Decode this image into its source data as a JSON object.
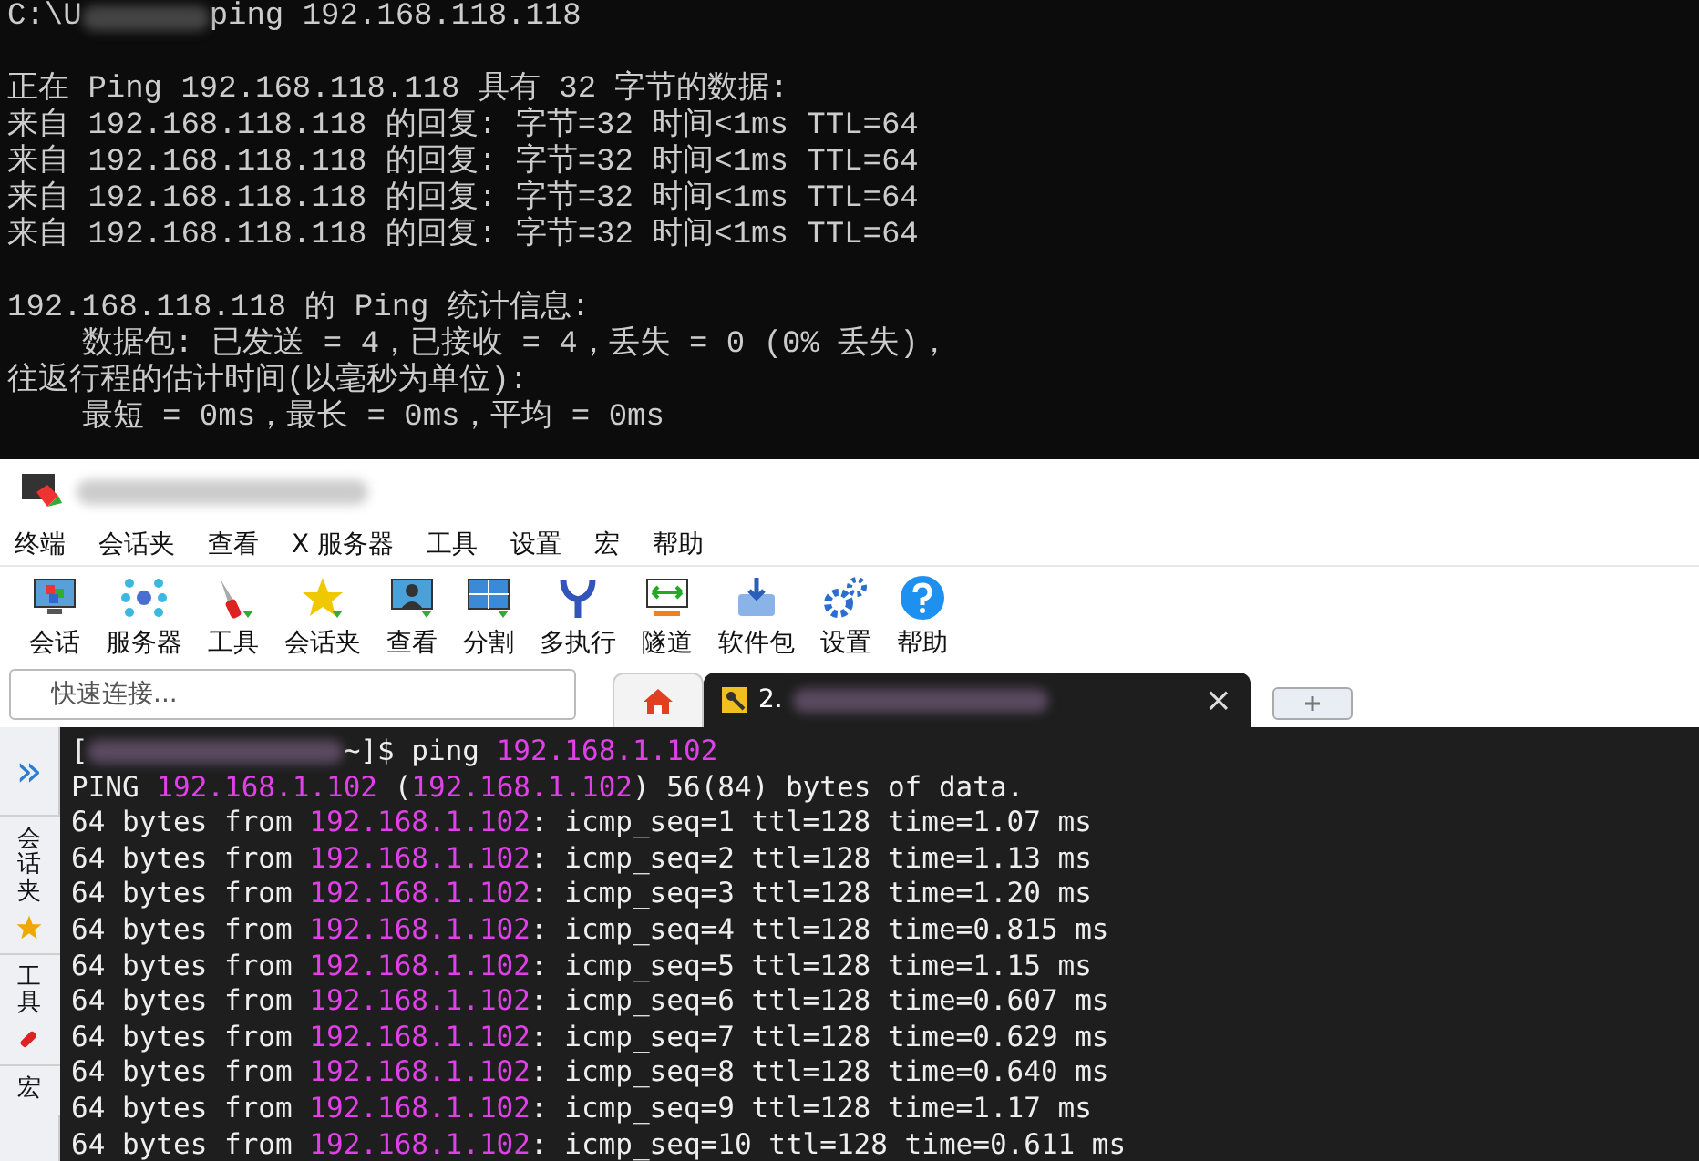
{
  "cmd": {
    "prompt_start": "C:\\U",
    "command": "ping 192.168.118.118",
    "lines": [
      {
        "text": "正在 Ping 192.168.118.118 具有 32 字节的数据:",
        "gap_before": true
      },
      {
        "text": "来自 192.168.118.118 的回复: 字节=32 时间<1ms TTL=64",
        "gap_before": false
      },
      {
        "text": "来自 192.168.118.118 的回复: 字节=32 时间<1ms TTL=64",
        "gap_before": false
      },
      {
        "text": "来自 192.168.118.118 的回复: 字节=32 时间<1ms TTL=64",
        "gap_before": false
      },
      {
        "text": "来自 192.168.118.118 的回复: 字节=32 时间<1ms TTL=64",
        "gap_before": false
      },
      {
        "text": "192.168.118.118 的 Ping 统计信息:",
        "gap_before": true
      },
      {
        "text": "    数据包: 已发送 = 4，已接收 = 4，丢失 = 0 (0% 丢失)，",
        "gap_before": false
      },
      {
        "text": "往返行程的估计时间(以毫秒为单位):",
        "gap_before": false
      },
      {
        "text": "    最短 = 0ms，最长 = 0ms，平均 = 0ms",
        "gap_before": false
      }
    ]
  },
  "xshell": {
    "menu": [
      "终端",
      "会话夹",
      "查看",
      "X 服务器",
      "工具",
      "设置",
      "宏",
      "帮助"
    ],
    "toolbar": [
      {
        "kind": "session",
        "label": "会话"
      },
      {
        "kind": "server",
        "label": "服务器"
      },
      {
        "kind": "tools",
        "label": "工具"
      },
      {
        "kind": "favorites",
        "label": "会话夹"
      },
      {
        "kind": "view",
        "label": "查看"
      },
      {
        "kind": "split",
        "label": "分割"
      },
      {
        "kind": "multi",
        "label": "多执行"
      },
      {
        "kind": "tunnel",
        "label": "隧道"
      },
      {
        "kind": "package",
        "label": "软件包"
      },
      {
        "kind": "settings",
        "label": "设置"
      },
      {
        "kind": "help",
        "label": "帮助"
      }
    ],
    "quick_connect": {
      "placeholder": "快速连接..."
    },
    "tabs": [
      {
        "kind": "home",
        "selected": false
      },
      {
        "kind": "session",
        "label": "2.",
        "close": "×",
        "selected": true
      },
      {
        "kind": "new",
        "selected": false
      }
    ],
    "sidebar": {
      "expand": "»",
      "items": [
        {
          "label": "会话夹",
          "kind": "star"
        },
        {
          "label": "工具",
          "kind": "tools"
        },
        {
          "label": "宏",
          "kind": "none"
        }
      ]
    },
    "terminal": {
      "prompt_start": "[",
      "prompt_end": "~]$ ping ",
      "host": "192.168.1.102",
      "lines": [
        {
          "before": "PING ",
          "ip": "192.168.1.102",
          "after": " (",
          "ip2": "192.168.1.102",
          "after2": ") 56(84) bytes of data."
        },
        {
          "before": "64 bytes from ",
          "ip": "192.168.1.102",
          "after": ": icmp_seq=1 ttl=128 time=1.07 ms"
        },
        {
          "before": "64 bytes from ",
          "ip": "192.168.1.102",
          "after": ": icmp_seq=2 ttl=128 time=1.13 ms"
        },
        {
          "before": "64 bytes from ",
          "ip": "192.168.1.102",
          "after": ": icmp_seq=3 ttl=128 time=1.20 ms"
        },
        {
          "before": "64 bytes from ",
          "ip": "192.168.1.102",
          "after": ": icmp_seq=4 ttl=128 time=0.815 ms"
        },
        {
          "before": "64 bytes from ",
          "ip": "192.168.1.102",
          "after": ": icmp_seq=5 ttl=128 time=1.15 ms"
        },
        {
          "before": "64 bytes from ",
          "ip": "192.168.1.102",
          "after": ": icmp_seq=6 ttl=128 time=0.607 ms"
        },
        {
          "before": "64 bytes from ",
          "ip": "192.168.1.102",
          "after": ": icmp_seq=7 ttl=128 time=0.629 ms"
        },
        {
          "before": "64 bytes from ",
          "ip": "192.168.1.102",
          "after": ": icmp_seq=8 ttl=128 time=0.640 ms"
        },
        {
          "before": "64 bytes from ",
          "ip": "192.168.1.102",
          "after": ": icmp_seq=9 ttl=128 time=1.17 ms"
        },
        {
          "before": "64 bytes from ",
          "ip": "192.168.1.102",
          "after": ": icmp_seq=10 ttl=128 time=0.611 ms"
        }
      ]
    }
  }
}
